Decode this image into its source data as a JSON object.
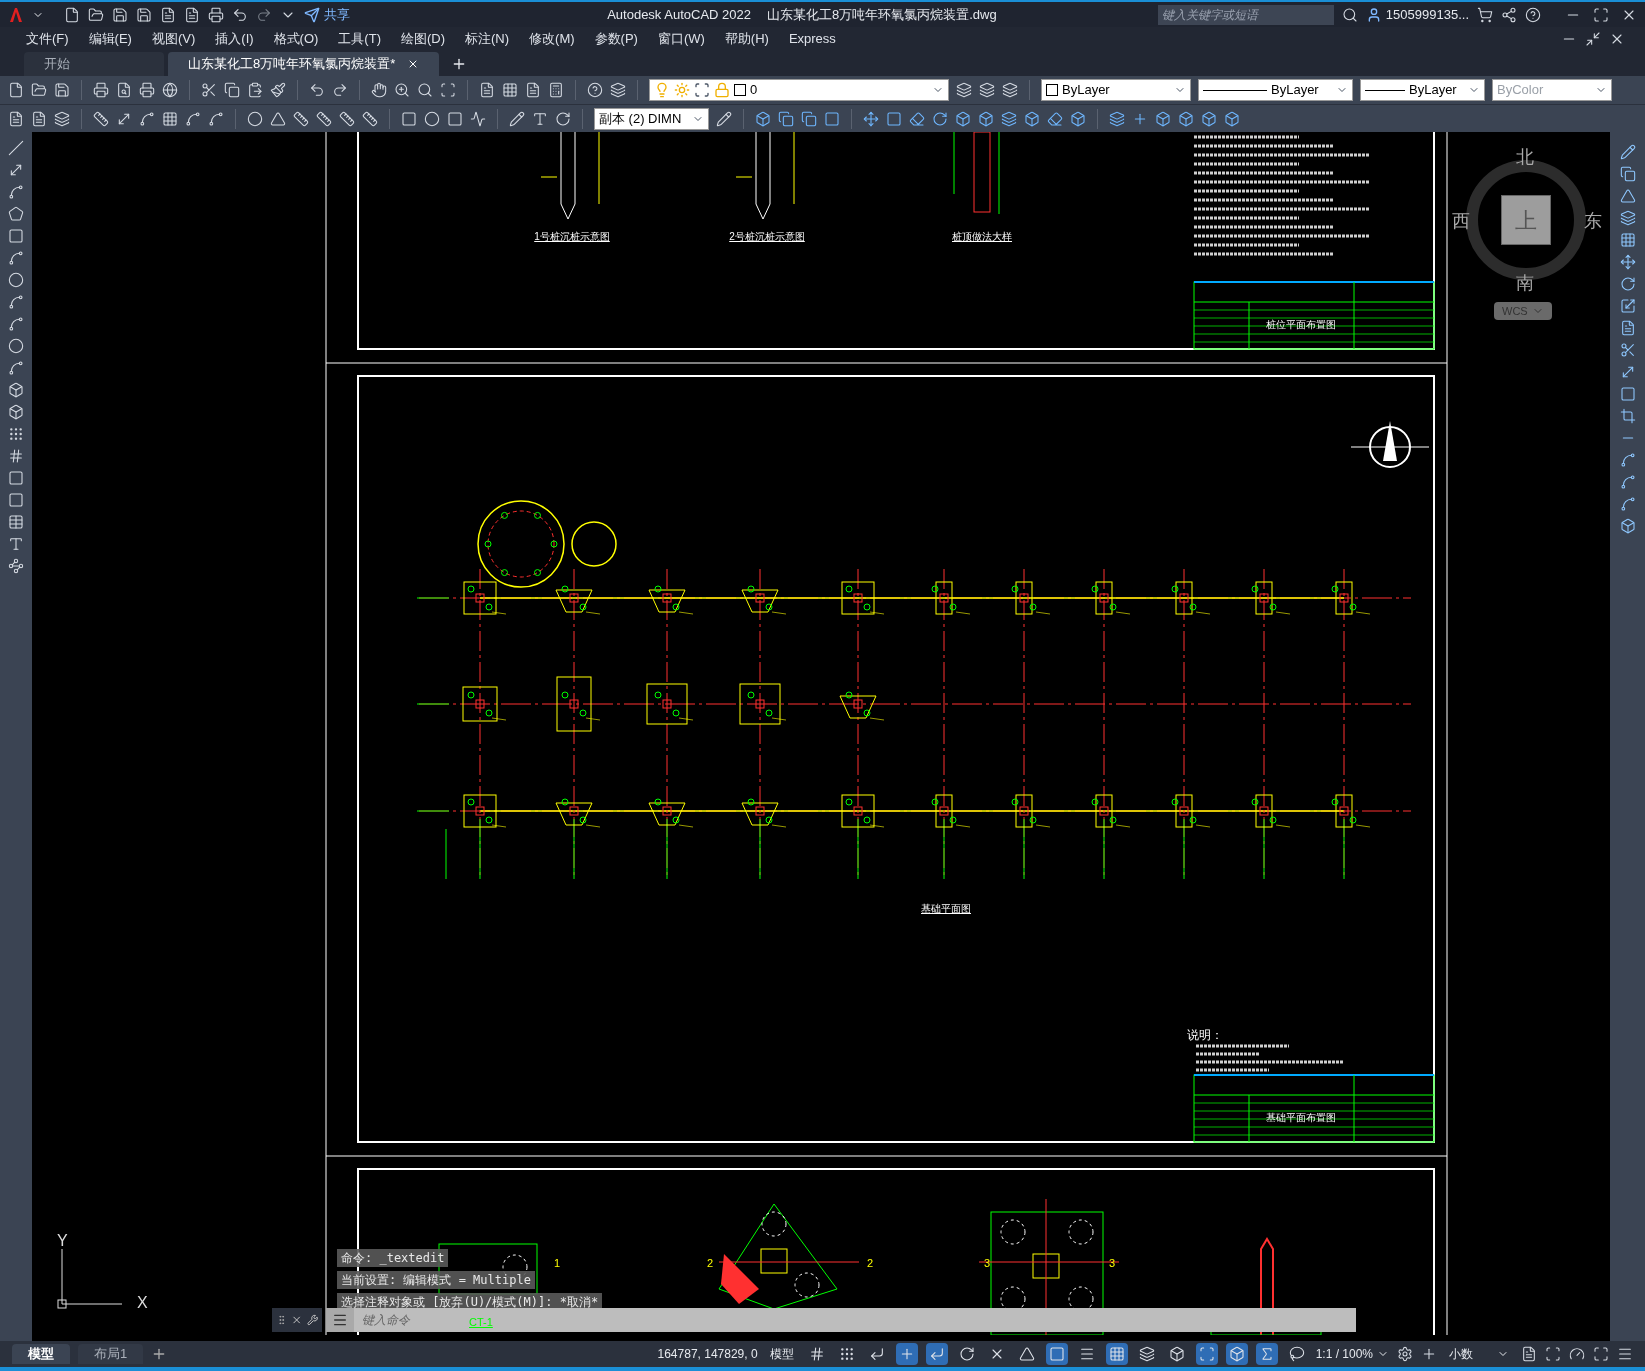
{
  "title_bar": {
    "share": "共享",
    "app_title": "Autodesk AutoCAD 2022",
    "file_name": "山东某化工8万吨年环氧氯丙烷装置.dwg",
    "search": {
      "placeholder": "键入关键字或短语"
    },
    "user": "1505999135..."
  },
  "menu": [
    "文件(F)",
    "编辑(E)",
    "视图(V)",
    "插入(I)",
    "格式(O)",
    "工具(T)",
    "绘图(D)",
    "标注(N)",
    "修改(M)",
    "参数(P)",
    "窗口(W)",
    "帮助(H)",
    "Express"
  ],
  "doc_tabs": [
    {
      "label": "开始",
      "selected": false
    },
    {
      "label": "山东某化工8万吨年环氧氯丙烷装置*",
      "selected": true
    }
  ],
  "properties": {
    "layer": "0",
    "color_setting": "ByLayer",
    "linetype": "ByLayer",
    "lineweight": "ByLayer",
    "plot_style": "ByColor"
  },
  "dim_style": "副本 (2) DIMN",
  "viewcube": {
    "north": "北",
    "west": "西",
    "east": "东",
    "south": "南",
    "top": "上",
    "ucs": "WCS"
  },
  "ucs_icon": {
    "y": "Y",
    "x": "X"
  },
  "drawing": {
    "top_sheet": {
      "captions": [
        "1号桩沉桩示意图",
        "2号桩沉桩示意图",
        "桩顶做法大样"
      ],
      "title_block": "桩位平面布置图"
    },
    "middle_sheet": {
      "caption": "基础平面图",
      "notes_heading": "说明：",
      "title_block": "基础平面布置图"
    },
    "bottom_sheet": {
      "section_marks": [
        "1",
        "2",
        "2",
        "3",
        "3"
      ],
      "label": "CT-1"
    }
  },
  "command_history": [
    "命令: _textedit",
    "当前设置: 编辑模式 = Multiple",
    "选择注释对象或 [放弃(U)/模式(M)]: *取消*"
  ],
  "command_input": {
    "placeholder": "键入命令"
  },
  "layout_tabs": [
    {
      "label": "模型",
      "selected": true
    },
    {
      "label": "布局1",
      "selected": false
    }
  ],
  "status_bar": {
    "coordinates": "164787, 147829, 0",
    "space": "模型",
    "scale": "1:1 / 100%",
    "units": "小数"
  },
  "status_toggles": [
    {
      "kind": "grid",
      "on": false
    },
    {
      "kind": "snap",
      "on": false
    },
    {
      "kind": "infer",
      "on": false
    },
    {
      "kind": "dynamic",
      "on": true
    },
    {
      "kind": "ortho",
      "on": true
    },
    {
      "kind": "polar",
      "on": false
    },
    {
      "kind": "isodraft",
      "on": false
    },
    {
      "kind": "angle",
      "on": false
    },
    {
      "kind": "osnap",
      "on": true
    },
    {
      "kind": "lineweight",
      "on": false
    },
    {
      "kind": "transparency",
      "on": true
    },
    {
      "kind": "cycling",
      "on": false
    },
    {
      "kind": "osnap3d",
      "on": false
    },
    {
      "kind": "ucs",
      "on": true
    },
    {
      "kind": "gizmo",
      "on": true
    },
    {
      "kind": "annotation",
      "on": true
    },
    {
      "kind": "autoscale",
      "on": false
    }
  ]
}
